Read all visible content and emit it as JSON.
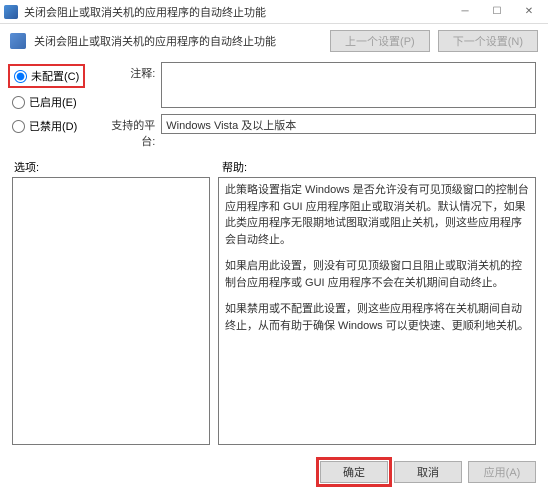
{
  "window": {
    "title": "关闭会阻止或取消关机的应用程序的自动终止功能"
  },
  "header": {
    "title": "关闭会阻止或取消关机的应用程序的自动终止功能",
    "prev": "上一个设置(P)",
    "next": "下一个设置(N)"
  },
  "radios": {
    "unconfigured": "未配置(C)",
    "enabled": "已启用(E)",
    "disabled": "已禁用(D)"
  },
  "form": {
    "comment_label": "注释:",
    "platform_label": "支持的平台:",
    "platform_value": "Windows Vista 及以上版本"
  },
  "mid": {
    "options": "选项:",
    "help": "帮助:"
  },
  "help": {
    "p1": "此策略设置指定 Windows 是否允许没有可见顶级窗口的控制台应用程序和 GUI 应用程序阻止或取消关机。默认情况下，如果此类应用程序无限期地试图取消或阻止关机，则这些应用程序会自动终止。",
    "p2": "如果启用此设置，则没有可见顶级窗口且阻止或取消关机的控制台应用程序或 GUI 应用程序不会在关机期间自动终止。",
    "p3": "如果禁用或不配置此设置，则这些应用程序将在关机期间自动终止，从而有助于确保 Windows 可以更快速、更顺利地关机。"
  },
  "footer": {
    "ok": "确定",
    "cancel": "取消",
    "apply": "应用(A)"
  }
}
